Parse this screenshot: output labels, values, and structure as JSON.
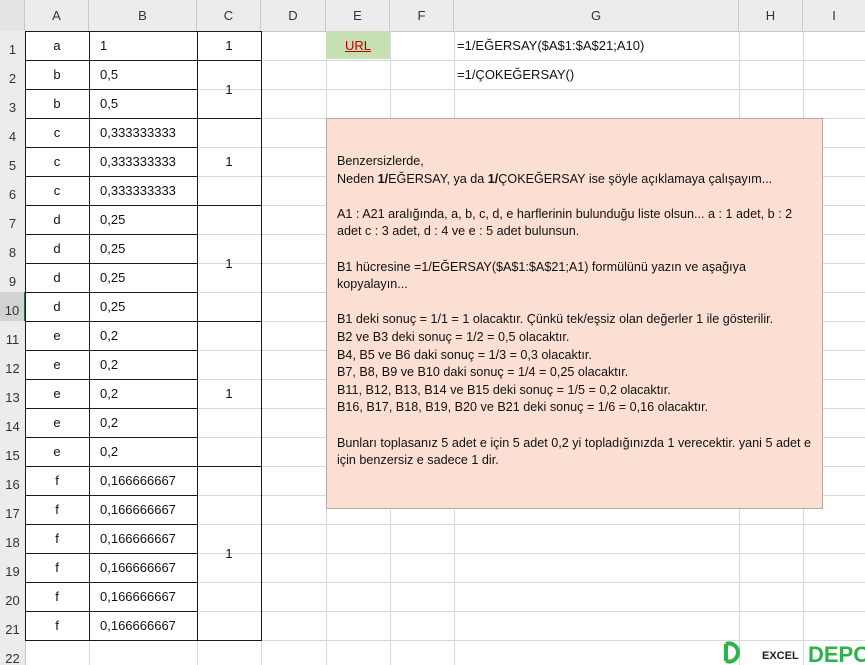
{
  "columns": [
    "A",
    "B",
    "C",
    "D",
    "E",
    "F",
    "G",
    "H",
    "I"
  ],
  "rows": [
    "1",
    "2",
    "3",
    "4",
    "5",
    "6",
    "7",
    "8",
    "9",
    "10",
    "11",
    "12",
    "13",
    "14",
    "15",
    "16",
    "17",
    "18",
    "19",
    "20",
    "21",
    "22"
  ],
  "selected_row": "10",
  "col_a": [
    "a",
    "b",
    "b",
    "c",
    "c",
    "c",
    "d",
    "d",
    "d",
    "d",
    "e",
    "e",
    "e",
    "e",
    "e",
    "f",
    "f",
    "f",
    "f",
    "f",
    "f"
  ],
  "col_b": [
    "1",
    "0,5",
    "0,5",
    "0,333333333",
    "0,333333333",
    "0,333333333",
    "0,25",
    "0,25",
    "0,25",
    "0,25",
    "0,2",
    "0,2",
    "0,2",
    "0,2",
    "0,2",
    "0,166666667",
    "0,166666667",
    "0,166666667",
    "0,166666667",
    "0,166666667",
    "0,166666667"
  ],
  "col_c_groups": [
    {
      "rows": "1",
      "value": "1"
    },
    {
      "rows": "2-3",
      "value": "1"
    },
    {
      "rows": "4-6",
      "value": "1"
    },
    {
      "rows": "7-10",
      "value": "1"
    },
    {
      "rows": "11-15",
      "value": "1"
    },
    {
      "rows": "16-21",
      "value": "1"
    }
  ],
  "url_cell": {
    "label": "URL",
    "color": "#c6e0b4"
  },
  "formula_g1": "=1/EĞERSAY($A$1:$A$21;A10)",
  "formula_g2": "=1/ÇOKEĞERSAY()",
  "note": {
    "bg_color": "#fbdfd3",
    "line1": "Benzersizlerde,",
    "line2_a": "Neden ",
    "line2_b": "1/",
    "line2_c": "EĞERSAY, ya da ",
    "line2_d": "1/",
    "line2_e": "ÇOKEĞERSAY ise şöyle açıklamaya çalışayım...",
    "para2": "A1 : A21 aralığında, a, b, c, d, e harflerinin bulunduğu liste olsun... a : 1 adet, b : 2 adet c : 3 adet, d : 4  ve e : 5 adet bulunsun.",
    "para3": "B1 hücresine =1/EĞERSAY($A$1:$A$21;A1) formülünü yazın ve aşağıya kopyalayın...",
    "results": [
      "B1 deki sonuç = 1/1 = 1 olacaktır. Çünkü tek/eşsiz olan değerler 1 ile gösterilir.",
      "B2 ve B3 deki sonuç = 1/2 = 0,5 olacaktır.",
      "B4, B5 ve B6 daki sonuç = 1/3 = 0,3 olacaktır.",
      "B7, B8, B9 ve B10 daki sonuç = 1/4 = 0,25 olacaktır.",
      "B11, B12, B13, B14 ve B15 deki sonuç = 1/5 = 0,2 olacaktır.",
      "B16, B17, B18, B19, B20 ve B21 deki sonuç = 1/6 = 0,16 olacaktır."
    ],
    "para5": "Bunları toplasanız 5 adet e için 5 adet 0,2 yi topladığınızda 1 verecektir. yani 5 adet e için benzersiz e sadece 1 dir."
  },
  "logo": {
    "text_a": "EXCEL",
    "text_b": "DEPO",
    "green": "#2eb34a"
  }
}
